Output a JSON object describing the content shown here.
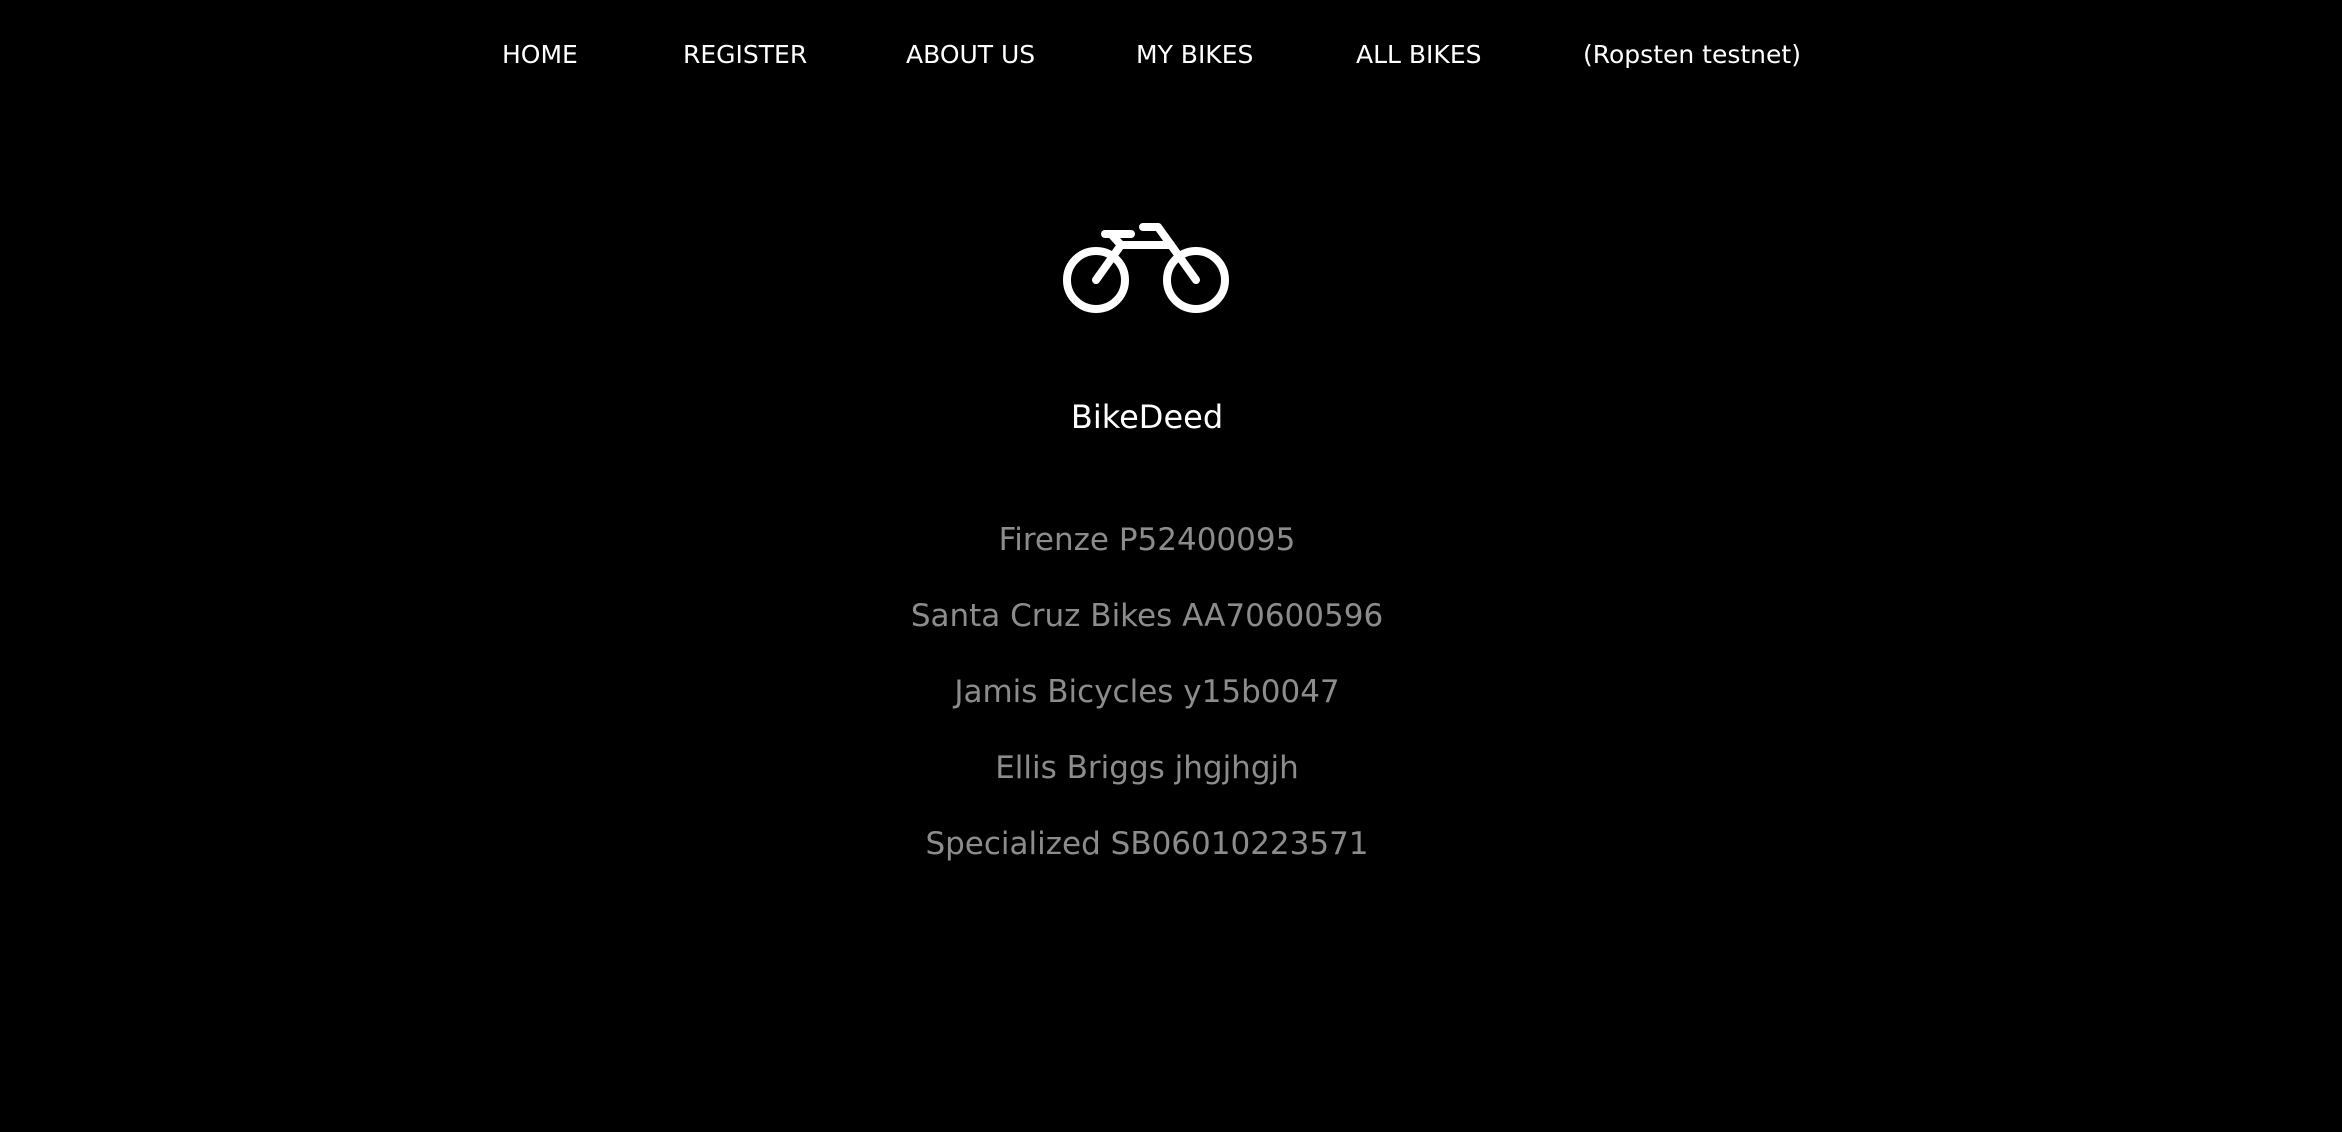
{
  "nav": {
    "items": [
      {
        "label": "HOME"
      },
      {
        "label": "REGISTER"
      },
      {
        "label": "ABOUT US"
      },
      {
        "label": "MY BIKES"
      },
      {
        "label": "ALL BIKES"
      },
      {
        "label": "(Ropsten testnet)"
      }
    ]
  },
  "brand": {
    "icon": "bicycle-icon",
    "name": "BikeDeed"
  },
  "bikes": [
    {
      "label": "Firenze P52400095"
    },
    {
      "label": "Santa Cruz Bikes AA70600596"
    },
    {
      "label": "Jamis Bicycles y15b0047"
    },
    {
      "label": "Ellis Briggs jhgjhgjh"
    },
    {
      "label": "Specialized SB06010223571"
    }
  ],
  "colors": {
    "background": "#000000",
    "nav_text": "#ffffff",
    "list_text": "#8c8c8c"
  }
}
